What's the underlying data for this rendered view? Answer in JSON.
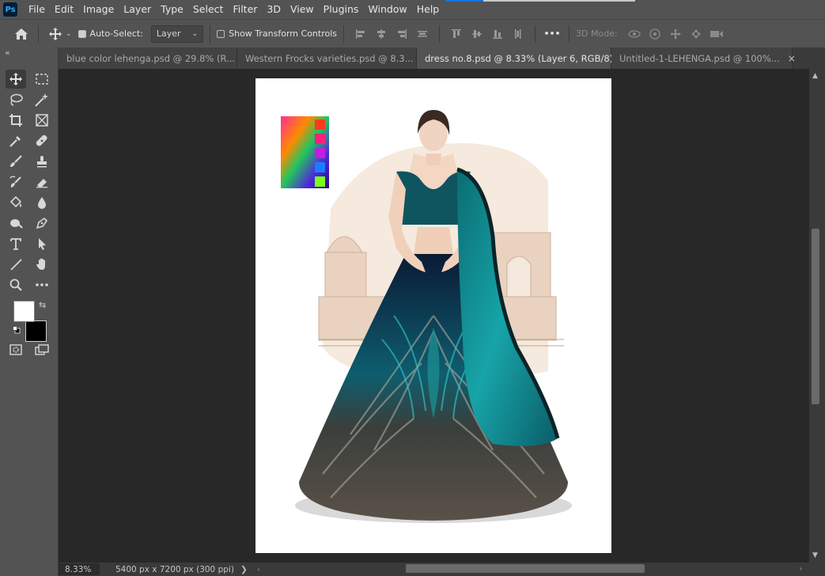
{
  "app": {
    "logo_text": "Ps"
  },
  "menu": [
    "File",
    "Edit",
    "Image",
    "Layer",
    "Type",
    "Select",
    "Filter",
    "3D",
    "View",
    "Plugins",
    "Window",
    "Help"
  ],
  "options": {
    "auto_select_label": "Auto-Select:",
    "auto_select_checked": true,
    "layer_dropdown_value": "Layer",
    "show_transform_label": "Show Transform Controls",
    "show_transform_checked": false,
    "three_d_mode_label": "3D Mode:",
    "more_label": "•••"
  },
  "tabs": [
    {
      "label": "blue color lehenga.psd @ 29.8% (R...",
      "active": false,
      "close": "×"
    },
    {
      "label": "Western Frocks varieties.psd @ 8.3...",
      "active": false,
      "close": "×"
    },
    {
      "label": "dress no.8.psd @ 8.33% (Layer 6, RGB/8)",
      "active": true,
      "close": "×"
    },
    {
      "label": "Untitled-1-LEHENGA.psd @ 100%...",
      "active": false,
      "close": "×"
    }
  ],
  "tools": [
    "move-tool",
    "marquee-tool",
    "lasso-tool",
    "magic-wand-tool",
    "crop-tool",
    "frame-tool",
    "eyedropper-tool",
    "healing-brush-tool",
    "brush-tool",
    "clone-stamp-tool",
    "history-brush-tool",
    "eraser-tool",
    "paint-bucket-tool",
    "blur-tool",
    "dodge-tool",
    "pen-tool",
    "type-tool",
    "path-selection-tool",
    "line-tool",
    "hand-tool",
    "zoom-tool",
    "more-tools"
  ],
  "colors": {
    "foreground": "#ffffff",
    "background": "#000000",
    "accent": "#1473e6"
  },
  "status": {
    "zoom": "8.33%",
    "doc_info": "5400 px x 7200 px (300 ppi)",
    "arrow": "❯"
  }
}
